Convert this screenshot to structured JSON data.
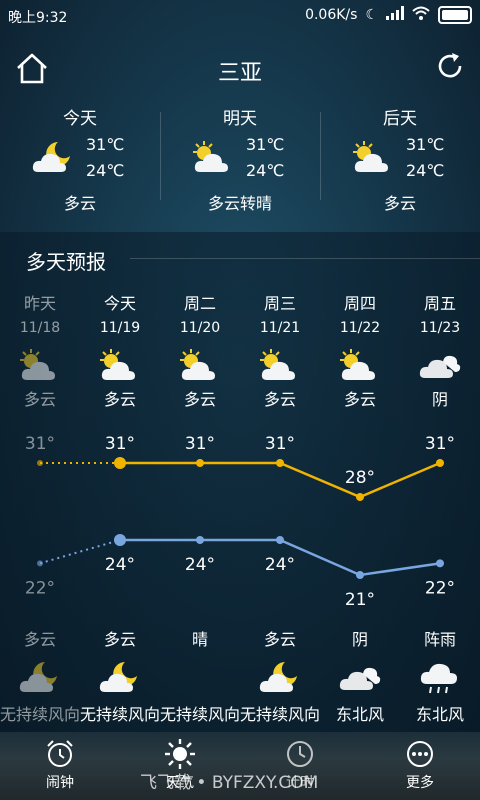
{
  "status": {
    "time": "晚上9:32",
    "speed": "0.06K/s"
  },
  "header": {
    "city": "三亚"
  },
  "summary": [
    {
      "label": "今天",
      "high": "31℃",
      "low": "24℃",
      "cond": "多云",
      "icon": "partly-cloudy-night-icon"
    },
    {
      "label": "明天",
      "high": "31℃",
      "low": "24℃",
      "cond": "多云转晴",
      "icon": "partly-sunny-icon"
    },
    {
      "label": "后天",
      "high": "31℃",
      "low": "24℃",
      "cond": "多云",
      "icon": "partly-sunny-icon"
    }
  ],
  "forecast_title": "多天预报",
  "days": [
    {
      "name": "昨天",
      "date": "11/18",
      "day_cond": "多云",
      "night_cond": "多云",
      "wind": "无持续风向",
      "day_icon": "partly-sunny-icon",
      "night_icon": "partly-cloudy-night-icon"
    },
    {
      "name": "今天",
      "date": "11/19",
      "day_cond": "多云",
      "night_cond": "多云",
      "wind": "无持续风向",
      "day_icon": "partly-sunny-icon",
      "night_icon": "partly-cloudy-night-icon"
    },
    {
      "name": "周二",
      "date": "11/20",
      "day_cond": "多云",
      "night_cond": "晴",
      "wind": "无持续风向",
      "day_icon": "partly-sunny-icon",
      "night_icon": "moon-icon"
    },
    {
      "name": "周三",
      "date": "11/21",
      "day_cond": "多云",
      "night_cond": "多云",
      "wind": "无持续风向",
      "day_icon": "partly-sunny-icon",
      "night_icon": "partly-cloudy-night-icon"
    },
    {
      "name": "周四",
      "date": "11/22",
      "day_cond": "多云",
      "night_cond": "阴",
      "wind": "东北风",
      "day_icon": "partly-sunny-icon",
      "night_icon": "cloud-icon"
    },
    {
      "name": "周五",
      "date": "11/23",
      "day_cond": "阴",
      "night_cond": "阵雨",
      "wind": "东北风",
      "day_icon": "cloud-icon",
      "night_icon": "rain-icon"
    }
  ],
  "chart_data": {
    "type": "line",
    "categories": [
      "11/18",
      "11/19",
      "11/20",
      "11/21",
      "11/22",
      "11/23"
    ],
    "series": [
      {
        "name": "",
        "color": "#f0b400",
        "values": [
          31,
          31,
          31,
          31,
          28,
          31
        ],
        "labels": [
          "31°",
          "31°",
          "31°",
          "31°",
          "28°",
          "31°"
        ]
      },
      {
        "name": "",
        "color": "#7aa6e0",
        "values": [
          22,
          24,
          24,
          24,
          21,
          22
        ],
        "labels": [
          "22°",
          "24°",
          "24°",
          "24°",
          "21°",
          "22°"
        ]
      }
    ]
  },
  "nav": [
    {
      "label": "闹钟",
      "icon": "alarm-clock-icon"
    },
    {
      "label": "天气",
      "icon": "sun-icon"
    },
    {
      "label": "计时",
      "icon": "timer-icon"
    },
    {
      "label": "更多",
      "icon": "more-icon"
    }
  ],
  "watermark": "飞飞载 • BYFZXY.COM",
  "colors": {
    "high": "#f0b400",
    "low": "#7aa6e0"
  }
}
